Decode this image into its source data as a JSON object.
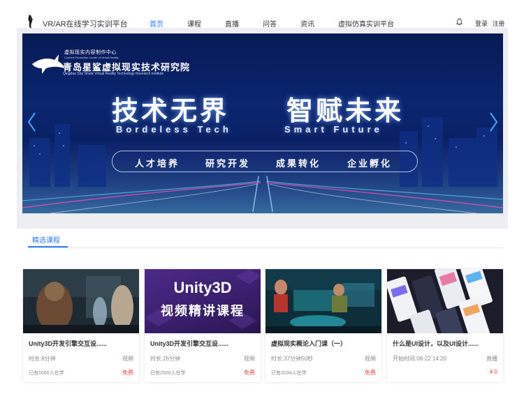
{
  "header": {
    "site_title": "VR/AR在线学习实训平台",
    "nav": [
      {
        "label": "首页",
        "active": true
      },
      {
        "label": "课程",
        "active": false
      },
      {
        "label": "直播",
        "active": false
      },
      {
        "label": "问答",
        "active": false
      },
      {
        "label": "资讯",
        "active": false
      },
      {
        "label": "虚拟仿真实训平台",
        "active": false
      }
    ],
    "login": "登录",
    "register": "注册",
    "accent_color": "#2a7ef5"
  },
  "banner": {
    "org_cn_small": "虚拟现实内容制作中心",
    "org_en_small": "Content Production Center of Virtual Reality",
    "org_cn": "青岛星鲨虚拟现实技术研究院",
    "org_en": "Qingdao Star Shark Virtual Reality Technology Research Institute",
    "headline_1": "技术无界",
    "headline_2": "智赋未来",
    "subline_1": "Bordeless Tech",
    "subline_2": "Smart Future",
    "pillars": [
      "人才培养",
      "研究开发",
      "成果转化",
      "企业孵化"
    ]
  },
  "section": {
    "tab_label": "精选课程"
  },
  "courses": [
    {
      "title": "Unity3D开发引擎交互设......",
      "duration": "时长:8分钟",
      "type": "视频",
      "learners": "已有1000人在学",
      "price": "免费"
    },
    {
      "title": "Unity3D开发引擎交互设......",
      "duration": "时长:26分钟",
      "type": "视频",
      "learners": "已有2500人在学",
      "price": "免费",
      "thumb_line1": "Unity3D",
      "thumb_line2": "视频精讲课程"
    },
    {
      "title": "虚拟现实概论入门课（一）",
      "duration": "时长:37分钟50秒",
      "type": "视频",
      "learners": "已有2034人在学",
      "price": "免费"
    },
    {
      "title": "什么是UI设计，以及UI设计......",
      "duration": "开始时间:08-22 14:20",
      "type": "直播",
      "learners": "",
      "price": "¥ 0"
    }
  ]
}
